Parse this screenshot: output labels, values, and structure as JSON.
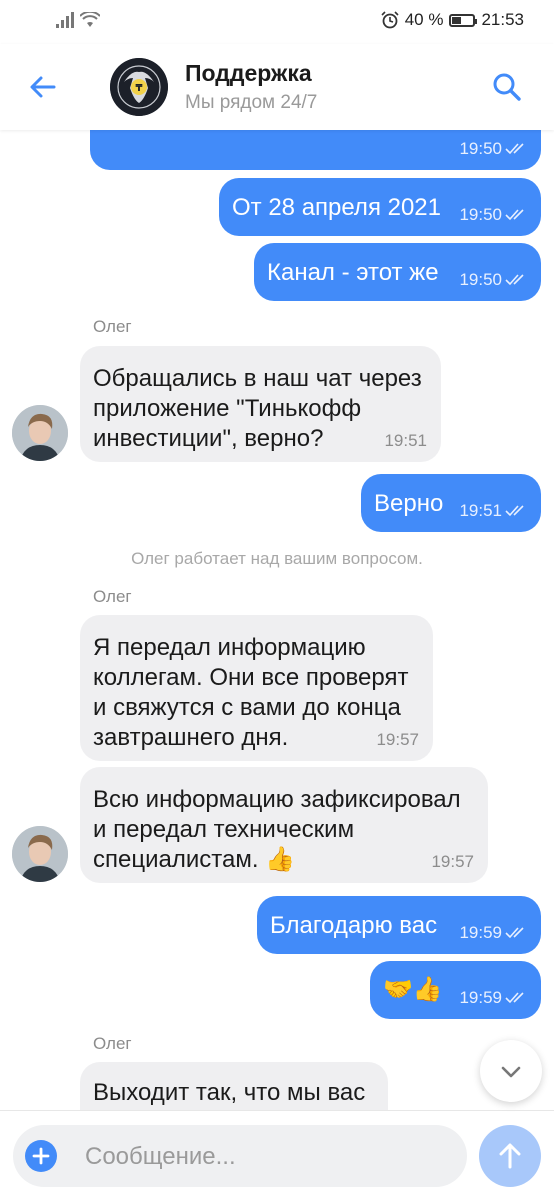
{
  "status_bar": {
    "battery": "40 %",
    "time": "21:53"
  },
  "header": {
    "title": "Поддержка",
    "subtitle": "Мы рядом 24/7"
  },
  "messages": [
    {
      "time": "19:50"
    },
    {
      "text": "От 28 апреля 2021",
      "time": "19:50"
    },
    {
      "text": "Канал - этот же",
      "time": "19:50"
    },
    {
      "sender": "Олег"
    },
    {
      "lines": [
        "Обращались в наш чат через",
        "приложение \"Тинькофф",
        "инвестиции\", верно?"
      ],
      "time": "19:51"
    },
    {
      "text": "Верно",
      "time": "19:51"
    },
    {
      "system": "Олег работает над вашим вопросом."
    },
    {
      "sender": "Олег"
    },
    {
      "lines": [
        "Я передал информацию",
        "коллегам. Они все проверят",
        "и свяжутся с вами до конца",
        "завтрашнего дня."
      ],
      "time": "19:57"
    },
    {
      "lines": [
        "Всю информацию зафиксировал",
        "и передал техническим",
        "специалистам. 👍"
      ],
      "time": "19:57"
    },
    {
      "text": "Благодарю вас",
      "time": "19:59"
    },
    {
      "text": "🤝👍",
      "time": "19:59"
    },
    {
      "sender": "Олег"
    },
    {
      "lines": [
        "Выходит так, что мы вас"
      ]
    }
  ],
  "composer": {
    "placeholder": "Сообщение..."
  },
  "icons": {
    "back": "arrow-left-icon",
    "search": "search-icon",
    "plus": "plus-icon",
    "send": "arrow-up-icon",
    "scroll": "chevron-down-icon",
    "read": "double-check-icon"
  },
  "colors": {
    "accent": "#428bf9",
    "incoming": "#efeff1",
    "send_disabled": "#a8c8fa"
  }
}
